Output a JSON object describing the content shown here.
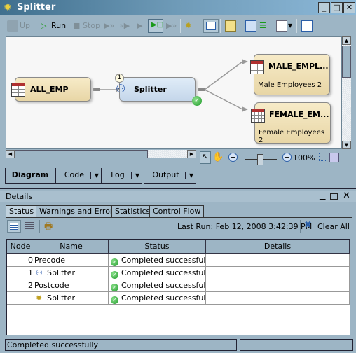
{
  "window": {
    "title": "Splitter",
    "icon": "gear-icon",
    "controls": [
      "minimize",
      "maximize",
      "close"
    ]
  },
  "toolbar": {
    "up": "Up",
    "run": "Run",
    "stop": "Stop"
  },
  "diagram": {
    "nodes": [
      {
        "id": "all_emp",
        "label": "ALL_EMP"
      },
      {
        "id": "splitter",
        "label": "Splitter",
        "badge": "1",
        "status": "success"
      },
      {
        "id": "male",
        "label": "MALE_EMPL...",
        "sublabel": "Male Employees 2"
      },
      {
        "id": "female",
        "label": "FEMALE_EM...",
        "sublabel": "Female Employees 2"
      }
    ],
    "zoom": "100%"
  },
  "tabs": [
    {
      "label": "Diagram",
      "active": true
    },
    {
      "label": "Code"
    },
    {
      "label": "Log"
    },
    {
      "label": "Output"
    }
  ],
  "details": {
    "title": "Details",
    "tabs": [
      "Status",
      "Warnings and Errors",
      "Statistics",
      "Control Flow"
    ],
    "last_run": "Last Run: Feb 12, 2008 3:42:39 PM",
    "clear_all": "Clear All",
    "columns": [
      "Node",
      "Name",
      "Status",
      "Details"
    ],
    "rows": [
      {
        "node": "0",
        "name": "Precode",
        "icon": "",
        "status": "Completed successfully",
        "details": ""
      },
      {
        "node": "1",
        "name": "Splitter",
        "icon": "splitter-icon",
        "status": "Completed successfully",
        "details": ""
      },
      {
        "node": "2",
        "name": "Postcode",
        "icon": "",
        "status": "Completed successfully",
        "details": ""
      },
      {
        "node": "",
        "name": "Splitter",
        "icon": "gear-icon",
        "status": "Completed successfully",
        "details": ""
      }
    ]
  },
  "statusbar": {
    "message": "Completed successfully"
  },
  "colors": {
    "success": "#1f9a2a",
    "titlebar": "#3f6f8e",
    "window_bg": "#9db5c5"
  }
}
